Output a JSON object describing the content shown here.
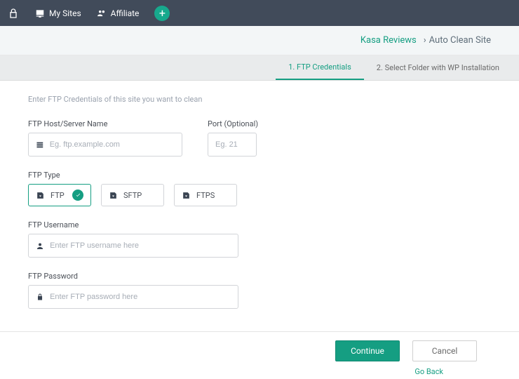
{
  "nav": {
    "my_sites": "My Sites",
    "affiliate": "Affiliate"
  },
  "breadcrumb": {
    "site": "Kasa Reviews",
    "separator": "›",
    "page": "Auto Clean Site"
  },
  "steps": {
    "step1": "1. FTP Credentials",
    "step2": "2. Select Folder with WP Installation"
  },
  "form": {
    "intro": "Enter FTP Credentials of this site you want to clean",
    "host_label": "FTP Host/Server Name",
    "host_placeholder": "Eg. ftp.example.com",
    "port_label": "Port (Optional)",
    "port_placeholder": "Eg. 21",
    "type_label": "FTP Type",
    "type_options": {
      "ftp": "FTP",
      "sftp": "SFTP",
      "ftps": "FTPS"
    },
    "username_label": "FTP Username",
    "username_placeholder": "Enter FTP username here",
    "password_label": "FTP Password",
    "password_placeholder": "Enter FTP password here"
  },
  "footer": {
    "continue": "Continue",
    "cancel": "Cancel",
    "go_back": "Go Back"
  },
  "colors": {
    "accent": "#159e82",
    "nav_bg": "#414b5a"
  }
}
